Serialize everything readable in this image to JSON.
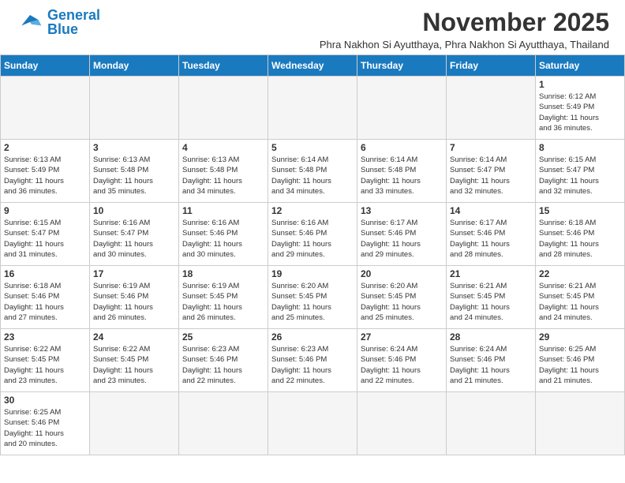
{
  "header": {
    "logo_general": "General",
    "logo_blue": "Blue",
    "month_title": "November 2025",
    "location": "Phra Nakhon Si Ayutthaya, Phra Nakhon Si Ayutthaya, Thailand"
  },
  "days_of_week": [
    "Sunday",
    "Monday",
    "Tuesday",
    "Wednesday",
    "Thursday",
    "Friday",
    "Saturday"
  ],
  "weeks": [
    [
      {
        "day": null,
        "info": null
      },
      {
        "day": null,
        "info": null
      },
      {
        "day": null,
        "info": null
      },
      {
        "day": null,
        "info": null
      },
      {
        "day": null,
        "info": null
      },
      {
        "day": null,
        "info": null
      },
      {
        "day": "1",
        "info": "Sunrise: 6:12 AM\nSunset: 5:49 PM\nDaylight: 11 hours\nand 36 minutes."
      }
    ],
    [
      {
        "day": "2",
        "info": "Sunrise: 6:13 AM\nSunset: 5:49 PM\nDaylight: 11 hours\nand 36 minutes."
      },
      {
        "day": "3",
        "info": "Sunrise: 6:13 AM\nSunset: 5:48 PM\nDaylight: 11 hours\nand 35 minutes."
      },
      {
        "day": "4",
        "info": "Sunrise: 6:13 AM\nSunset: 5:48 PM\nDaylight: 11 hours\nand 34 minutes."
      },
      {
        "day": "5",
        "info": "Sunrise: 6:14 AM\nSunset: 5:48 PM\nDaylight: 11 hours\nand 34 minutes."
      },
      {
        "day": "6",
        "info": "Sunrise: 6:14 AM\nSunset: 5:48 PM\nDaylight: 11 hours\nand 33 minutes."
      },
      {
        "day": "7",
        "info": "Sunrise: 6:14 AM\nSunset: 5:47 PM\nDaylight: 11 hours\nand 32 minutes."
      },
      {
        "day": "8",
        "info": "Sunrise: 6:15 AM\nSunset: 5:47 PM\nDaylight: 11 hours\nand 32 minutes."
      }
    ],
    [
      {
        "day": "9",
        "info": "Sunrise: 6:15 AM\nSunset: 5:47 PM\nDaylight: 11 hours\nand 31 minutes."
      },
      {
        "day": "10",
        "info": "Sunrise: 6:16 AM\nSunset: 5:47 PM\nDaylight: 11 hours\nand 30 minutes."
      },
      {
        "day": "11",
        "info": "Sunrise: 6:16 AM\nSunset: 5:46 PM\nDaylight: 11 hours\nand 30 minutes."
      },
      {
        "day": "12",
        "info": "Sunrise: 6:16 AM\nSunset: 5:46 PM\nDaylight: 11 hours\nand 29 minutes."
      },
      {
        "day": "13",
        "info": "Sunrise: 6:17 AM\nSunset: 5:46 PM\nDaylight: 11 hours\nand 29 minutes."
      },
      {
        "day": "14",
        "info": "Sunrise: 6:17 AM\nSunset: 5:46 PM\nDaylight: 11 hours\nand 28 minutes."
      },
      {
        "day": "15",
        "info": "Sunrise: 6:18 AM\nSunset: 5:46 PM\nDaylight: 11 hours\nand 28 minutes."
      }
    ],
    [
      {
        "day": "16",
        "info": "Sunrise: 6:18 AM\nSunset: 5:46 PM\nDaylight: 11 hours\nand 27 minutes."
      },
      {
        "day": "17",
        "info": "Sunrise: 6:19 AM\nSunset: 5:46 PM\nDaylight: 11 hours\nand 26 minutes."
      },
      {
        "day": "18",
        "info": "Sunrise: 6:19 AM\nSunset: 5:45 PM\nDaylight: 11 hours\nand 26 minutes."
      },
      {
        "day": "19",
        "info": "Sunrise: 6:20 AM\nSunset: 5:45 PM\nDaylight: 11 hours\nand 25 minutes."
      },
      {
        "day": "20",
        "info": "Sunrise: 6:20 AM\nSunset: 5:45 PM\nDaylight: 11 hours\nand 25 minutes."
      },
      {
        "day": "21",
        "info": "Sunrise: 6:21 AM\nSunset: 5:45 PM\nDaylight: 11 hours\nand 24 minutes."
      },
      {
        "day": "22",
        "info": "Sunrise: 6:21 AM\nSunset: 5:45 PM\nDaylight: 11 hours\nand 24 minutes."
      }
    ],
    [
      {
        "day": "23",
        "info": "Sunrise: 6:22 AM\nSunset: 5:45 PM\nDaylight: 11 hours\nand 23 minutes."
      },
      {
        "day": "24",
        "info": "Sunrise: 6:22 AM\nSunset: 5:45 PM\nDaylight: 11 hours\nand 23 minutes."
      },
      {
        "day": "25",
        "info": "Sunrise: 6:23 AM\nSunset: 5:46 PM\nDaylight: 11 hours\nand 22 minutes."
      },
      {
        "day": "26",
        "info": "Sunrise: 6:23 AM\nSunset: 5:46 PM\nDaylight: 11 hours\nand 22 minutes."
      },
      {
        "day": "27",
        "info": "Sunrise: 6:24 AM\nSunset: 5:46 PM\nDaylight: 11 hours\nand 22 minutes."
      },
      {
        "day": "28",
        "info": "Sunrise: 6:24 AM\nSunset: 5:46 PM\nDaylight: 11 hours\nand 21 minutes."
      },
      {
        "day": "29",
        "info": "Sunrise: 6:25 AM\nSunset: 5:46 PM\nDaylight: 11 hours\nand 21 minutes."
      }
    ],
    [
      {
        "day": "30",
        "info": "Sunrise: 6:25 AM\nSunset: 5:46 PM\nDaylight: 11 hours\nand 20 minutes."
      },
      {
        "day": null,
        "info": null
      },
      {
        "day": null,
        "info": null
      },
      {
        "day": null,
        "info": null
      },
      {
        "day": null,
        "info": null
      },
      {
        "day": null,
        "info": null
      },
      {
        "day": null,
        "info": null
      }
    ]
  ]
}
